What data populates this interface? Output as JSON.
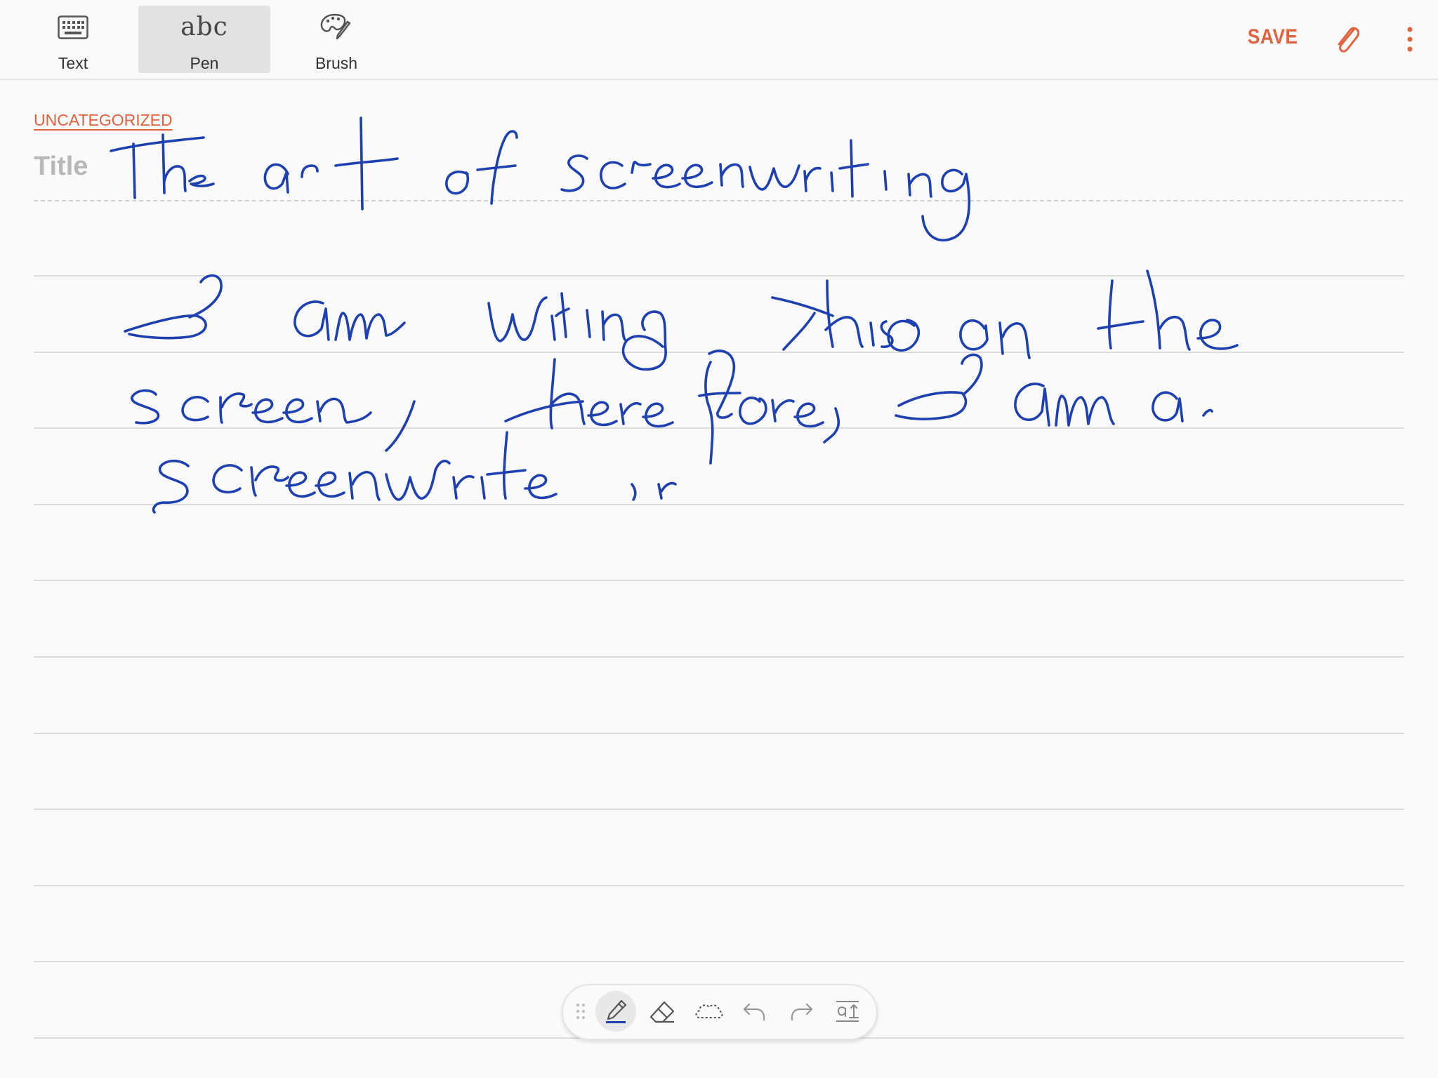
{
  "toolbar": {
    "modes": [
      {
        "label": "Text",
        "icon": "keyboard-icon"
      },
      {
        "label": "Pen",
        "icon": "abc-handwriting-icon",
        "glyph": "abc",
        "active": true
      },
      {
        "label": "Brush",
        "icon": "palette-brush-icon"
      }
    ],
    "save_label": "SAVE",
    "attach_icon": "paperclip-icon",
    "more_icon": "more-vertical-icon"
  },
  "note": {
    "category": "UNCATEGORIZED",
    "title_placeholder": "Title",
    "handwritten_title": "The art of screenwriting",
    "handwritten_body": "I am writing this on the screen, therefore, I am a screenwriter."
  },
  "pen_toolbar": {
    "tools": [
      "drag-handle-icon",
      "pen-icon",
      "eraser-icon",
      "lasso-select-icon",
      "undo-icon",
      "redo-icon",
      "convert-to-text-icon"
    ],
    "active_tool": "pen-icon"
  },
  "colors": {
    "accent": "#e0623f",
    "ink": "#1e40b0",
    "ruled_line": "#dcdcdc",
    "active_bg": "#e2e2e2"
  }
}
